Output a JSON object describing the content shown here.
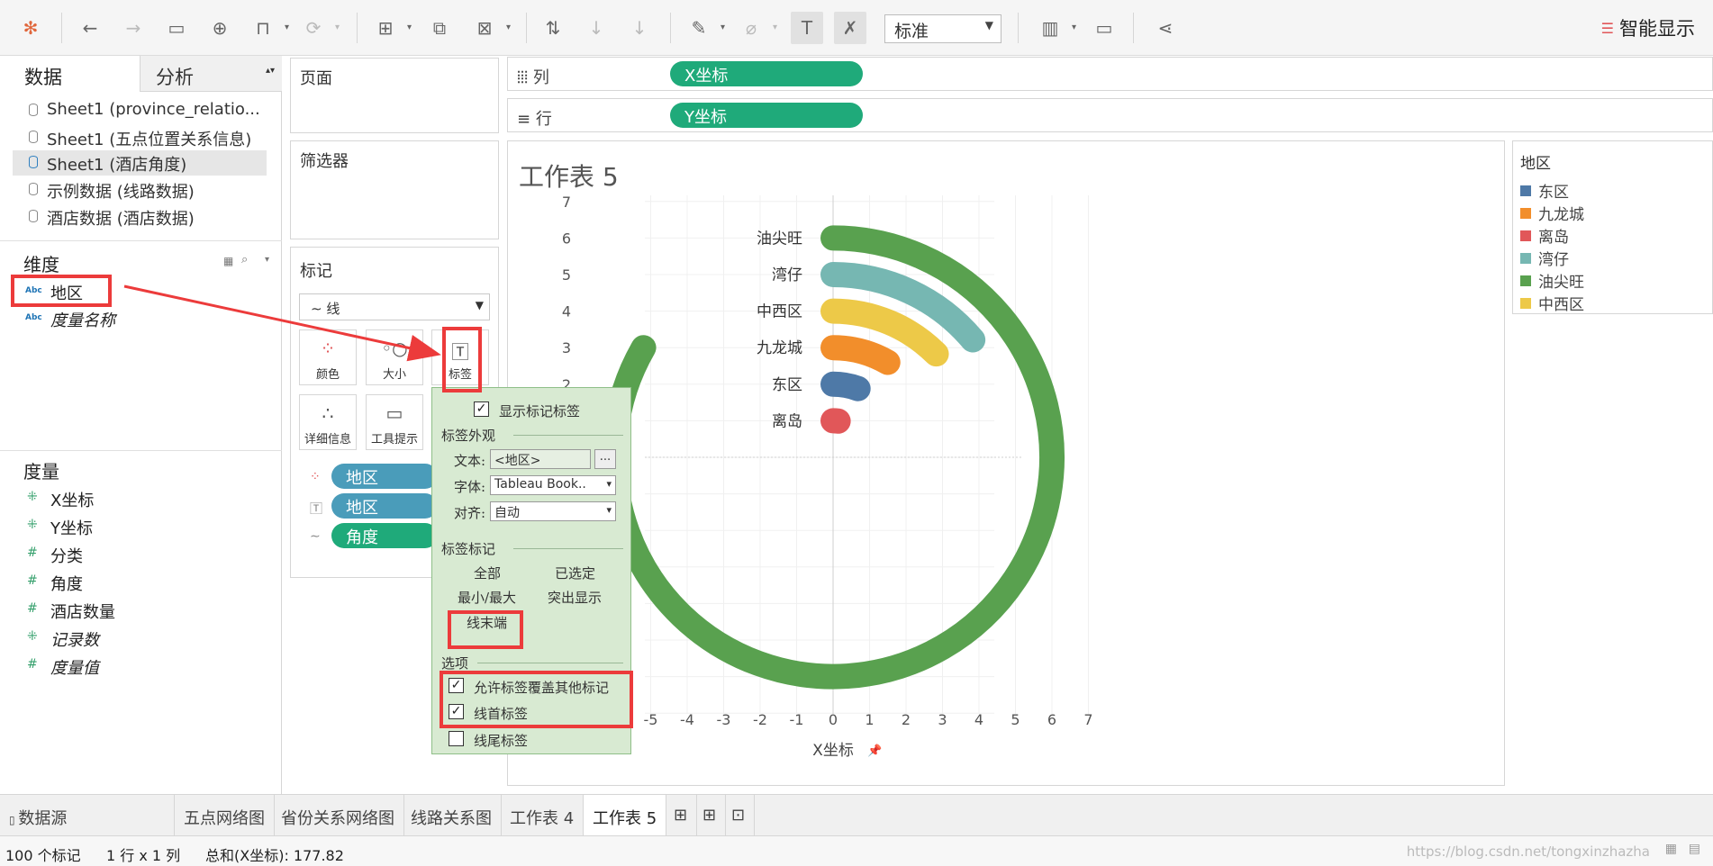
{
  "toolbar": {
    "view_mode": "标准",
    "smart_show": "智能显示",
    "icons": [
      "tableau-logo-icon",
      "undo-icon",
      "redo-icon",
      "save-icon",
      "new-datasource-icon",
      "pause-icon",
      "refresh-icon",
      "new-sheet-icon",
      "duplicate-icon",
      "clear-icon",
      "swap-icon",
      "sort-asc-icon",
      "sort-desc-icon",
      "highlight-icon",
      "group-icon",
      "show-labels-icon",
      "fix-axes-icon",
      "fit-icon",
      "presentation-icon",
      "share-icon"
    ]
  },
  "left": {
    "tab_data": "数据",
    "tab_analysis": "分析",
    "sources": [
      "Sheet1 (province_relatio...",
      "Sheet1 (五点位置关系信息)",
      "Sheet1 (酒店角度)",
      "示例数据 (线路数据)",
      "酒店数据 (酒店数据)"
    ],
    "dimensions_title": "维度",
    "dimensions": [
      "地区",
      "度量名称"
    ],
    "dimension_type": "Abc",
    "measures_title": "度量",
    "measures": [
      "X坐标",
      "Y坐标",
      "分类",
      "角度",
      "酒店数量",
      "记录数",
      "度量值"
    ]
  },
  "cards": {
    "pages": "页面",
    "filters": "筛选器",
    "marks": "标记",
    "mark_type": "线",
    "buttons": [
      "颜色",
      "大小",
      "标签",
      "详细信息",
      "工具提示"
    ],
    "pills": [
      "地区",
      "地区",
      "角度"
    ]
  },
  "shelves": {
    "columns_label": "列",
    "columns_pill": "X坐标",
    "rows_label": "行",
    "rows_pill": "Y坐标"
  },
  "sheet_title": "工作表 5",
  "label_popup": {
    "show_labels": "显示标记标签",
    "appearance_title": "标签外观",
    "text_label": "文本:",
    "text_value": "<地区>",
    "more": "...",
    "font_label": "字体:",
    "font_value": "Tableau Book..",
    "align_label": "对齐:",
    "align_value": "自动",
    "marks_title": "标签标记",
    "opt_all": "全部",
    "opt_selected": "已选定",
    "opt_minmax": "最小/最大",
    "opt_highlight": "突出显示",
    "opt_line_end": "线末端",
    "options_title": "选项",
    "allow_overlap": "允许标签覆盖其他标记",
    "label_start": "线首标签",
    "label_end": "线尾标签"
  },
  "legend": {
    "title": "地区",
    "items": [
      {
        "name": "东区",
        "color": "#4e79a7"
      },
      {
        "name": "九龙城",
        "color": "#f28e2b"
      },
      {
        "name": "离岛",
        "color": "#e15759"
      },
      {
        "name": "湾仔",
        "color": "#76b7b2"
      },
      {
        "name": "油尖旺",
        "color": "#59a14f"
      },
      {
        "name": "中西区",
        "color": "#edc948"
      }
    ]
  },
  "chart_data": {
    "type": "line",
    "xlabel": "X坐标",
    "ylabel": "",
    "xlim": [
      -5,
      7
    ],
    "ylim": [
      -7,
      7
    ],
    "xticks": [
      -5,
      -4,
      -3,
      -2,
      -1,
      0,
      1,
      2,
      3,
      4,
      5,
      6,
      7
    ],
    "yticks": [
      7,
      6,
      5,
      4,
      3,
      2
    ],
    "series": [
      {
        "name": "油尖旺",
        "color": "#59a14f",
        "radius": 6,
        "start_angle_deg": 90,
        "sweep_deg": 300
      },
      {
        "name": "湾仔",
        "color": "#76b7b2",
        "radius": 5,
        "start_angle_deg": 90,
        "sweep_deg": 50
      },
      {
        "name": "中西区",
        "color": "#edc948",
        "radius": 4,
        "start_angle_deg": 90,
        "sweep_deg": 45
      },
      {
        "name": "九龙城",
        "color": "#f28e2b",
        "radius": 3,
        "start_angle_deg": 90,
        "sweep_deg": 30
      },
      {
        "name": "东区",
        "color": "#4e79a7",
        "radius": 2,
        "start_angle_deg": 90,
        "sweep_deg": 20
      },
      {
        "name": "离岛",
        "color": "#e15759",
        "radius": 1,
        "start_angle_deg": 90,
        "sweep_deg": 8
      }
    ]
  },
  "bottom_tabs": [
    "数据源",
    "五点网络图",
    "省份关系网络图",
    "线路关系图",
    "工作表 4",
    "工作表 5"
  ],
  "status": {
    "marks": "100 个标记",
    "rows_cols": "1 行 x 1 列",
    "sum": "总和(X坐标): 177.82",
    "watermark": "https://blog.csdn.net/tongxinzhazha"
  }
}
